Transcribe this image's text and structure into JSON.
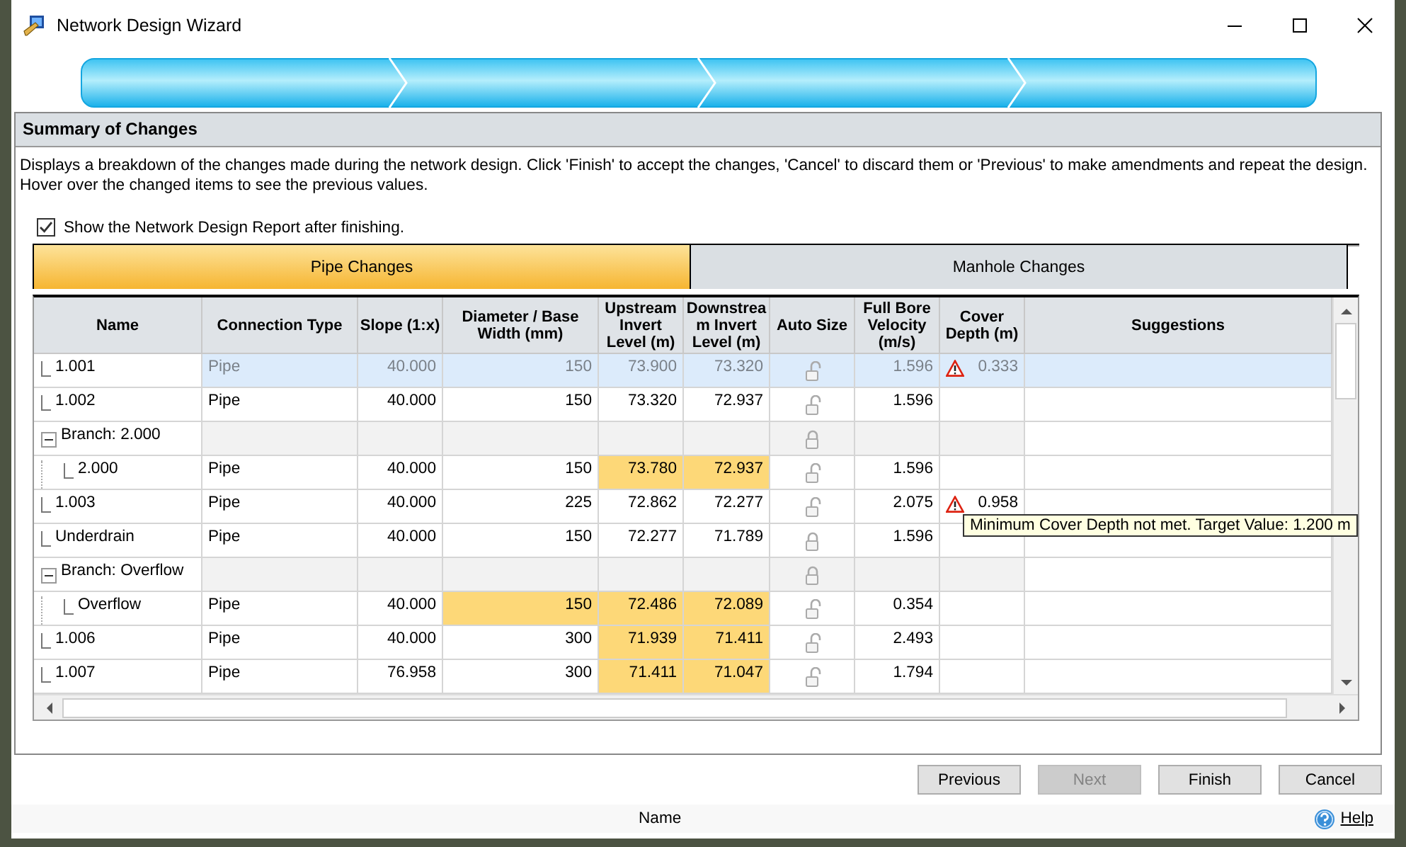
{
  "window": {
    "title": "Network Design Wizard"
  },
  "panel": {
    "title": "Summary of Changes",
    "description": "Displays a breakdown of the changes made during the network design. Click 'Finish' to accept the changes, 'Cancel' to discard them or 'Previous' to make amendments and repeat the design. Hover over the changed items to see the previous values.",
    "show_report": {
      "label": "Show the Network Design Report after finishing.",
      "checked": true
    }
  },
  "tabs": [
    {
      "label": "Pipe Changes",
      "selected": true
    },
    {
      "label": "Manhole Changes",
      "selected": false
    }
  ],
  "table": {
    "columns": [
      "Name",
      "Connection Type",
      "Slope (1:x)",
      "Diameter / Base Width (mm)",
      "Upstream Invert Level (m)",
      "Downstream Invert Level (m)",
      "Auto Size",
      "Full Bore Velocity (m/s)",
      "Cover Depth (m)",
      "Suggestions"
    ],
    "rows": [
      {
        "kind": "pipe",
        "name": "1.001",
        "selected": true,
        "locked": false,
        "cells": [
          {
            "text": "Pipe",
            "changed": false
          },
          {
            "text": "40.000",
            "changed": false
          },
          {
            "text": "150",
            "changed": false
          },
          {
            "text": "73.900",
            "changed": false
          },
          {
            "text": "73.320",
            "changed": false
          },
          {
            "text": "1.596",
            "changed": false
          },
          {
            "text": "0.333",
            "warning": true
          }
        ]
      },
      {
        "kind": "pipe",
        "name": "1.002",
        "selected": false,
        "locked": false,
        "cells": [
          {
            "text": "Pipe",
            "changed": false
          },
          {
            "text": "40.000",
            "changed": false
          },
          {
            "text": "150",
            "changed": false
          },
          {
            "text": "73.320",
            "changed": false
          },
          {
            "text": "72.937",
            "changed": false
          },
          {
            "text": "1.596",
            "changed": false
          }
        ]
      },
      {
        "kind": "branch",
        "name": "Branch: 2.000",
        "selected": false,
        "expanded": true,
        "locked": true,
        "children": [
          {
            "kind": "pipe",
            "name": "2.000",
            "selected": false,
            "locked": false,
            "cells": [
              {
                "text": "Pipe",
                "changed": false
              },
              {
                "text": "40.000",
                "changed": false
              },
              {
                "text": "150",
                "changed": false
              },
              {
                "text": "73.780",
                "changed": true
              },
              {
                "text": "72.937",
                "changed": true
              },
              {
                "text": "1.596",
                "changed": false
              }
            ]
          }
        ]
      },
      {
        "kind": "pipe",
        "name": "1.003",
        "selected": false,
        "locked": false,
        "cells": [
          {
            "text": "Pipe",
            "changed": false
          },
          {
            "text": "40.000",
            "changed": false
          },
          {
            "text": "225",
            "changed": false
          },
          {
            "text": "72.862",
            "changed": false
          },
          {
            "text": "72.277",
            "changed": false
          },
          {
            "text": "2.075",
            "changed": false
          },
          {
            "text": "0.958",
            "warning": true,
            "tooltip": "Minimum Cover Depth not met. Target Value: 1.200 m"
          }
        ]
      },
      {
        "kind": "pipe",
        "name": "Underdrain",
        "selected": false,
        "locked": true,
        "cells": [
          {
            "text": "Pipe",
            "changed": false
          },
          {
            "text": "40.000",
            "changed": false
          },
          {
            "text": "150",
            "changed": false
          },
          {
            "text": "72.277",
            "changed": false
          },
          {
            "text": "71.789",
            "changed": false
          },
          {
            "text": "1.596",
            "changed": false
          }
        ]
      },
      {
        "kind": "branch",
        "name": "Branch: Overflow",
        "selected": false,
        "expanded": true,
        "locked": true,
        "children": [
          {
            "kind": "pipe",
            "name": "Overflow",
            "selected": false,
            "locked": false,
            "cells": [
              {
                "text": "Pipe",
                "changed": false
              },
              {
                "text": "40.000",
                "changed": false
              },
              {
                "text": "150",
                "changed": true
              },
              {
                "text": "72.486",
                "changed": true
              },
              {
                "text": "72.089",
                "changed": true
              },
              {
                "text": "0.354",
                "changed": false
              }
            ]
          }
        ]
      },
      {
        "kind": "pipe",
        "name": "1.006",
        "selected": false,
        "locked": false,
        "cells": [
          {
            "text": "Pipe",
            "changed": false
          },
          {
            "text": "40.000",
            "changed": false
          },
          {
            "text": "300",
            "changed": false
          },
          {
            "text": "71.939",
            "changed": true
          },
          {
            "text": "71.411",
            "changed": true
          },
          {
            "text": "2.493",
            "changed": false
          }
        ]
      },
      {
        "kind": "pipe",
        "name": "1.007",
        "selected": false,
        "locked": false,
        "cells": [
          {
            "text": "Pipe",
            "changed": false
          },
          {
            "text": "76.958",
            "changed": false
          },
          {
            "text": "300",
            "changed": false
          },
          {
            "text": "71.411",
            "changed": true
          },
          {
            "text": "71.047",
            "changed": true
          },
          {
            "text": "1.794",
            "changed": false
          }
        ]
      }
    ]
  },
  "buttons": [
    {
      "label": "Previous",
      "disabled": false
    },
    {
      "label": "Next",
      "disabled": true
    },
    {
      "label": "Finish",
      "disabled": false
    },
    {
      "label": "Cancel",
      "disabled": false
    }
  ],
  "status_bar": {
    "text": "Name",
    "help": "Help"
  }
}
